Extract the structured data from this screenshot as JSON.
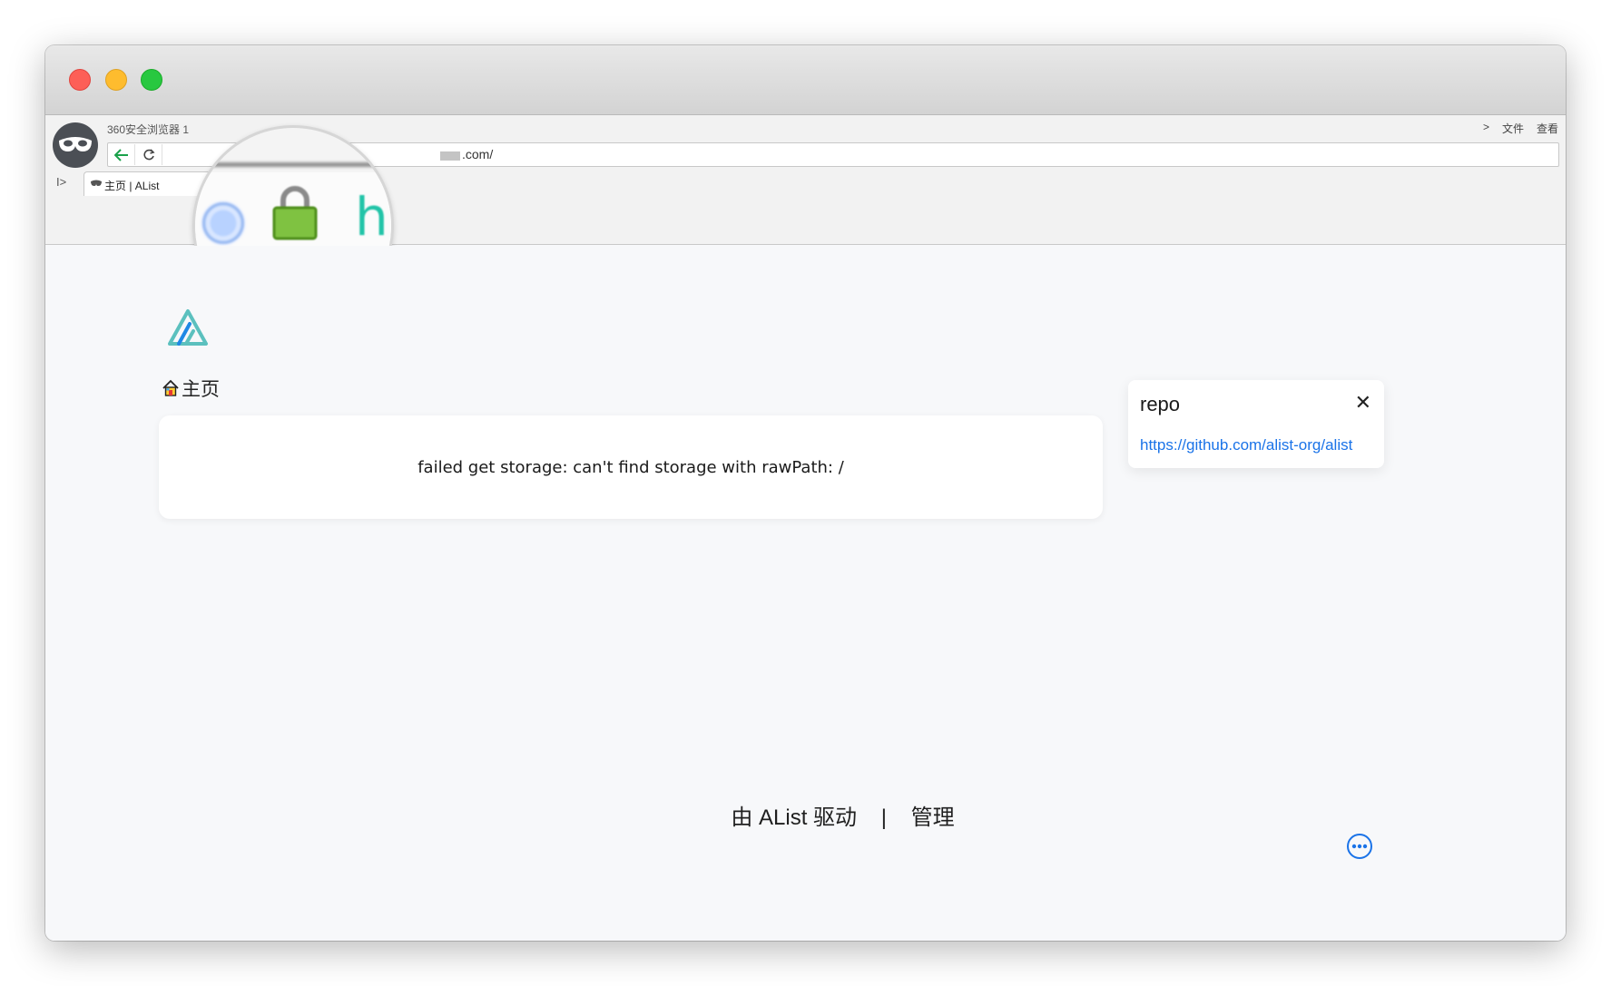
{
  "browser": {
    "name": "360安全浏览器 1",
    "menu": [
      "文件",
      "查看"
    ],
    "menu_chevron": ">",
    "url": ".com/",
    "tab_title": "主页 | AList",
    "tab_toggle": "I>"
  },
  "magnifier": {
    "zoomed_letter": "h",
    "icons": [
      "radio-dot-icon",
      "secure-lock-icon"
    ]
  },
  "page": {
    "breadcrumb_home": "主页",
    "error_message": "failed get storage: can't find storage with rawPath: /",
    "notice": {
      "title": "repo",
      "close": "✕",
      "link": "https://github.com/alist-org/alist"
    },
    "footer": {
      "powered_by": "由 AList 驱动",
      "separator": "|",
      "manage": "管理"
    }
  },
  "colors": {
    "accent": "#1a73e8",
    "logo_teal": "#5bc0be",
    "page_bg": "#f7f8fa"
  }
}
